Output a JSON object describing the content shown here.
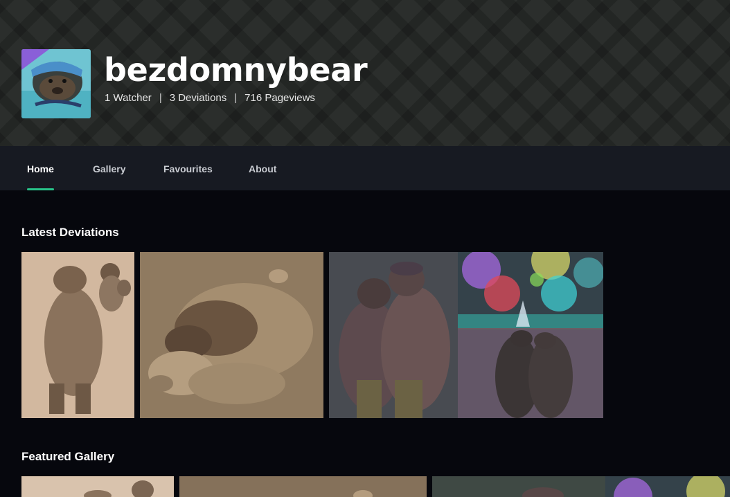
{
  "profile": {
    "username": "bezdomnybear",
    "stats": {
      "watchers": "1 Watcher",
      "deviations": "3 Deviations",
      "pageviews": "716 Pageviews",
      "separator": "|"
    }
  },
  "nav": {
    "tabs": [
      {
        "label": "Home",
        "active": true
      },
      {
        "label": "Gallery",
        "active": false
      },
      {
        "label": "Favourites",
        "active": false
      },
      {
        "label": "About",
        "active": false
      }
    ]
  },
  "sections": {
    "latest": {
      "title": "Latest Deviations"
    },
    "featured": {
      "title": "Featured Gallery"
    }
  },
  "colors": {
    "accent": "#28c48a",
    "background": "#06070d",
    "nav_background": "#171a22"
  }
}
